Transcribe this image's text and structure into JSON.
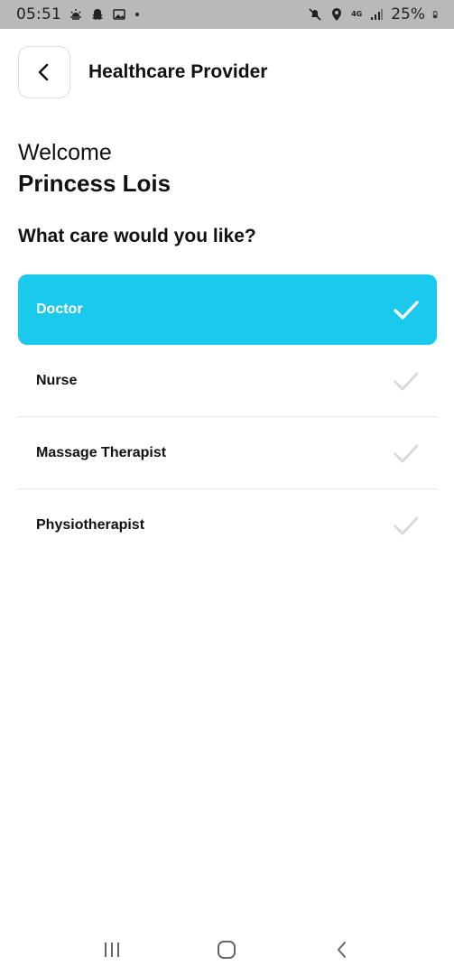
{
  "status_bar": {
    "time": "05:51",
    "network": "4G",
    "battery": "25%"
  },
  "header": {
    "title": "Healthcare Provider",
    "back_icon": "chevron-left-icon"
  },
  "welcome": {
    "greeting": "Welcome",
    "name": "Princess Lois"
  },
  "question": "What care would you like?",
  "care_options": [
    {
      "label": "Doctor",
      "selected": true
    },
    {
      "label": "Nurse",
      "selected": false
    },
    {
      "label": "Massage Therapist",
      "selected": false
    },
    {
      "label": "Physiotherapist",
      "selected": false
    }
  ],
  "colors": {
    "accent": "#1ac9ec",
    "check_inactive": "#d9d9d9",
    "check_active": "#ffffff"
  }
}
